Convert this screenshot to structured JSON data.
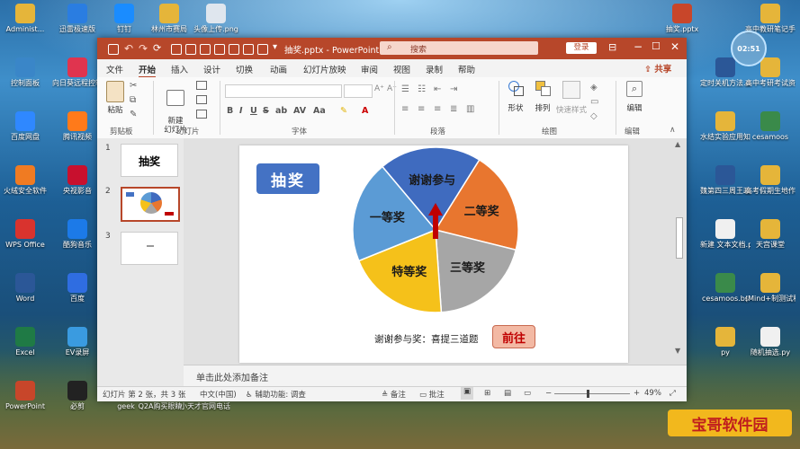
{
  "desktop": {
    "left_icons": [
      {
        "label": "Administ...",
        "color": "#e5b53a"
      },
      {
        "label": "迅雷极速版",
        "color": "#2a7de1"
      },
      {
        "label": "钉钉",
        "color": "#1a8cff"
      },
      {
        "label": "林州市赛局",
        "color": "#e5b53a"
      },
      {
        "label": "头像上传.png",
        "color": "#dfe6ee"
      },
      {
        "label": "控制面板",
        "color": "#3a86c8"
      },
      {
        "label": "向日葵远程控制",
        "color": "#e0344f"
      },
      {
        "label": "百度网盘",
        "color": "#2f88ff"
      },
      {
        "label": "腾讯视频",
        "color": "#ff7a1a"
      },
      {
        "label": "火绒安全软件",
        "color": "#f07b22"
      },
      {
        "label": "央视影音",
        "color": "#c8102e"
      },
      {
        "label": "WPS Office",
        "color": "#d9332e"
      },
      {
        "label": "酷狗音乐",
        "color": "#1c7ae8"
      },
      {
        "label": "Word",
        "color": "#2b5797"
      },
      {
        "label": "百度",
        "color": "#2f6de1"
      },
      {
        "label": "Excel",
        "color": "#1f7a45"
      },
      {
        "label": "EV录屏",
        "color": "#3a9be0"
      },
      {
        "label": "PowerPoint",
        "color": "#c8462a"
      },
      {
        "label": "必剪",
        "color": "#222222"
      }
    ],
    "bottom_labels": [
      "geek",
      "Q2A购买眼睛",
      "小天才官网电话"
    ],
    "right_icons": [
      {
        "label": "抽奖.pptx",
        "color": "#c8462a"
      },
      {
        "label": "高中教研笔记手",
        "color": "#e5b53a"
      },
      {
        "label": "定时关机方法.docx",
        "color": "#2b5797"
      },
      {
        "label": "高中考研考试资料",
        "color": "#e5b53a"
      },
      {
        "label": "水结实验应用知识",
        "color": "#e5b53a"
      },
      {
        "label": "cesamoos",
        "color": "#3a8a4a"
      },
      {
        "label": "魏第四三周王政...",
        "color": "#2b5797"
      },
      {
        "label": "高考假期生地作业答案",
        "color": "#e5b53a"
      },
      {
        "label": "新建 文本文档.py",
        "color": "#f0f0f0"
      },
      {
        "label": "天宫课堂",
        "color": "#e5b53a"
      },
      {
        "label": "cesamoos.bs",
        "color": "#3a8a4a"
      },
      {
        "label": "(Mind+制测试程序",
        "color": "#e5b53a"
      },
      {
        "label": "py",
        "color": "#e5b53a"
      },
      {
        "label": "随机抽选.py",
        "color": "#f0f0f0"
      }
    ],
    "clock": "02:51",
    "watermark": "宝哥软件园"
  },
  "titlebar": {
    "filename": "抽奖.pptx",
    "sep": "-",
    "app": "PowerPoint",
    "search_placeholder": "搜索",
    "login": "登录"
  },
  "tabs": [
    "文件",
    "开始",
    "插入",
    "设计",
    "切换",
    "动画",
    "幻灯片放映",
    "审阅",
    "视图",
    "录制",
    "帮助"
  ],
  "share_label": "共享",
  "ribbon": {
    "paste": "粘贴",
    "new_slide": "新建\n幻灯片",
    "groups": [
      "剪贴板",
      "幻灯片",
      "字体",
      "段落",
      "绘图",
      "编辑"
    ],
    "shape": "形状",
    "arrange": "排列",
    "quick_style": "快速样式",
    "edit": "编辑"
  },
  "thumbnails": [
    {
      "num": "1",
      "text": "抽奖"
    },
    {
      "num": "2",
      "text": ""
    },
    {
      "num": "3",
      "text": ""
    }
  ],
  "slide": {
    "title": "抽奖",
    "footer_text": "谢谢参与奖：喜提三道题",
    "go_button": "前往"
  },
  "chart_data": {
    "type": "pie",
    "categories": [
      "谢谢参与",
      "二等奖",
      "三等奖",
      "特等奖",
      "一等奖"
    ],
    "values": [
      20,
      20,
      20,
      20,
      20
    ],
    "colors": [
      "#3f6bbf",
      "#e8762f",
      "#a6a6a6",
      "#f5c11a",
      "#5b9bd5"
    ]
  },
  "notes_placeholder": "单击此处添加备注",
  "status": {
    "slide_info": "幻灯片 第 2 张，共 3 张",
    "language": "中文(中国)",
    "accessibility": "辅助功能: 调查",
    "notes": "备注",
    "comments": "批注",
    "zoom": "49%"
  }
}
